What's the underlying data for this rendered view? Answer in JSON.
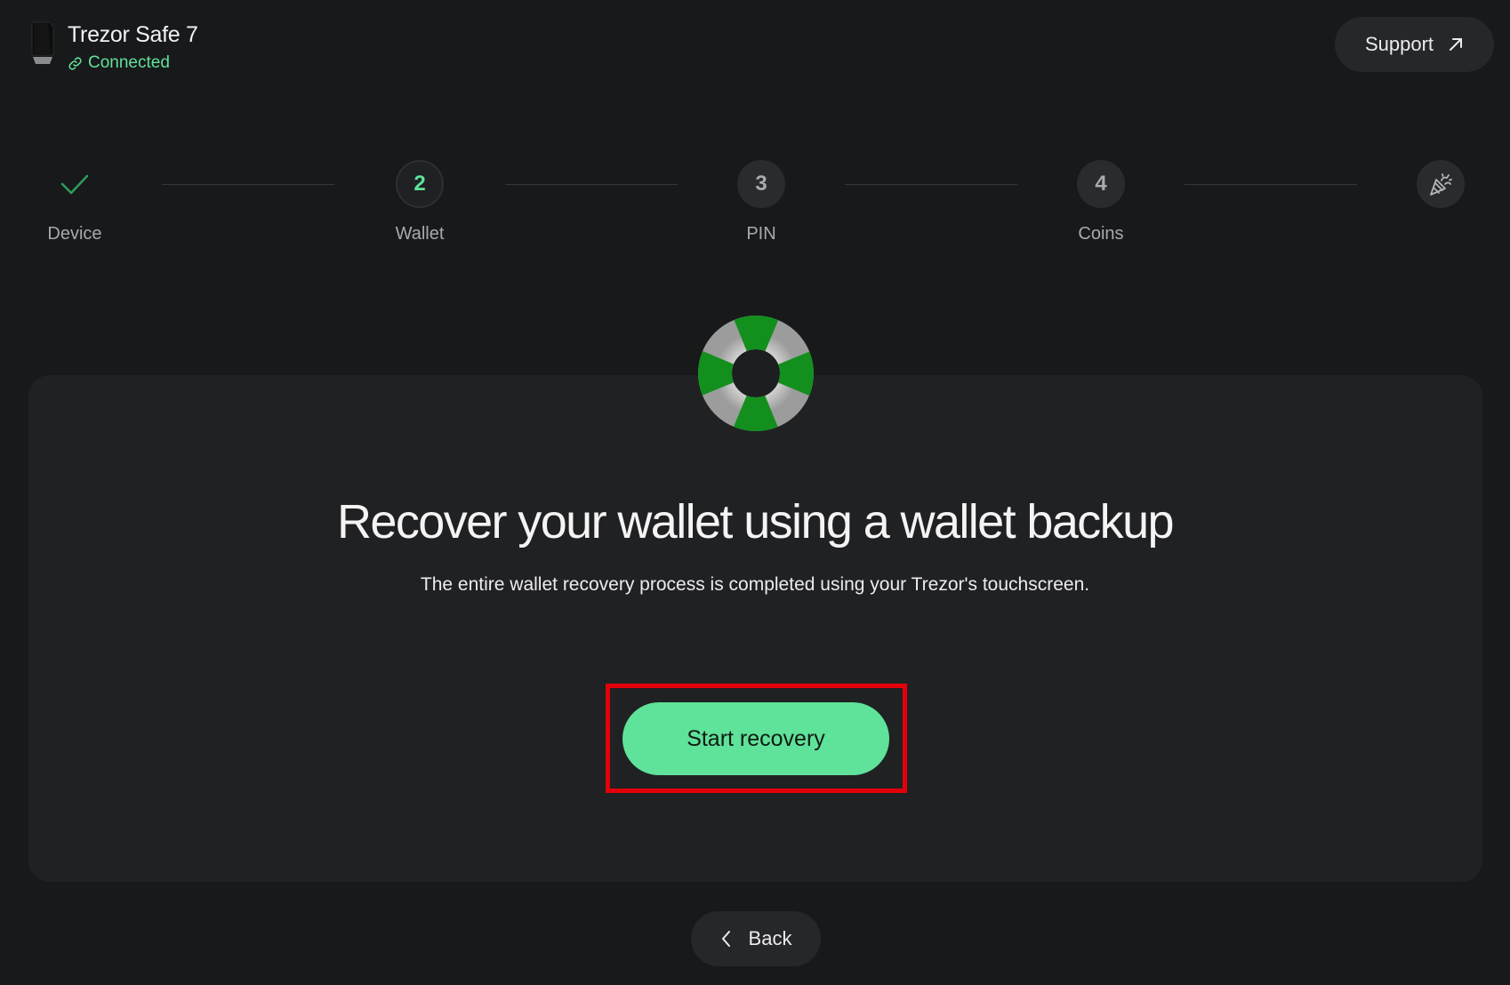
{
  "header": {
    "device_name": "Trezor Safe 7",
    "status": "Connected",
    "support_label": "Support"
  },
  "stepper": {
    "steps": [
      {
        "label": "Device",
        "number": "",
        "state": "done"
      },
      {
        "label": "Wallet",
        "number": "2",
        "state": "active"
      },
      {
        "label": "PIN",
        "number": "3",
        "state": "pending"
      },
      {
        "label": "Coins",
        "number": "4",
        "state": "pending"
      },
      {
        "label": "",
        "number": "",
        "state": "final"
      }
    ]
  },
  "main": {
    "icon": "lifebuoy-icon",
    "title": "Recover your wallet using a wallet backup",
    "subtitle": "The entire wallet recovery process is completed using your Trezor's touchscreen.",
    "primary_button": "Start recovery"
  },
  "footer": {
    "back_label": "Back"
  },
  "colors": {
    "background": "#18191b",
    "card": "#202123",
    "accent": "#5fe29a",
    "highlight": "#e4000b"
  }
}
